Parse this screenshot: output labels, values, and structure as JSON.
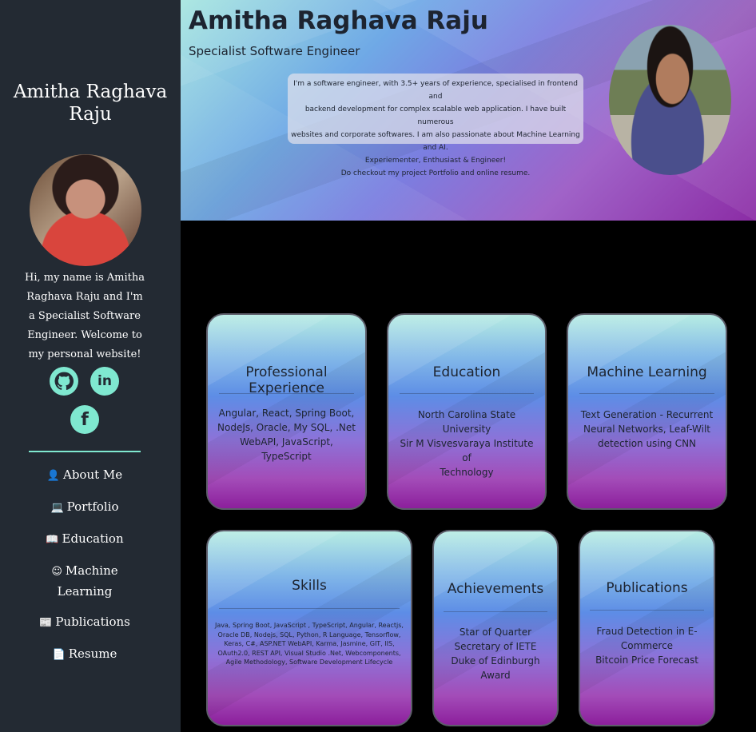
{
  "sidebar": {
    "name": "Amitha Raghava Raju",
    "intro": "Hi, my name is Amitha Raghava Raju and I'm a Specialist Software Engineer. Welcome to my personal website!",
    "nav": [
      {
        "label": "About Me",
        "icon": "user-icon"
      },
      {
        "label": "Portfolio",
        "icon": "laptop-icon"
      },
      {
        "label": "Education",
        "icon": "book-icon"
      },
      {
        "label": "Machine Learning",
        "icon": "accessibility-icon"
      },
      {
        "label": "Publications",
        "icon": "newspaper-icon"
      },
      {
        "label": "Resume",
        "icon": "file-icon"
      }
    ],
    "social": {
      "github_glyph": "⬤",
      "linkedin_glyph": "in",
      "facebook_glyph": "f"
    },
    "accent_color": "#7fe8d0"
  },
  "header": {
    "name": "Amitha Raghava Raju",
    "role": "Specialist Software Engineer",
    "bio_lines": [
      "I'm a software engineer, with 3.5+ years of experience, specialised in frontend and",
      "backend development for complex scalable web application. I have built numerous",
      "websites and corporate softwares. I am also passionate about Machine Learning and AI.",
      "Experiementer, Enthusiast & Engineer!",
      "Do checkout my project Portfolio and online resume."
    ]
  },
  "cards": {
    "experience": {
      "title": "Professional Experience",
      "lines": [
        "Angular, React, Spring Boot,",
        "NodeJs, Oracle, My SQL, .Net",
        "WebAPI, JavaScript, TypeScript"
      ]
    },
    "education": {
      "title": "Education",
      "lines": [
        "North Carolina State University",
        "Sir M Visvesvaraya Institute of",
        "Technology"
      ]
    },
    "ml": {
      "title": "Machine Learning",
      "lines": [
        "Text Generation - Recurrent",
        "Neural Networks, Leaf-Wilt",
        "detection using CNN"
      ]
    },
    "skills": {
      "title": "Skills",
      "lines": [
        "Java, Spring Boot, JavaScript , TypeScript, Angular, Reactjs,",
        "Oracle DB, Nodejs, SQL, Python, R Language, Tensorflow,",
        "Keras, C#, ASP.NET WebAPI, Karma, Jasmine, GIT, IIS,",
        "OAuth2.0, REST API, Visual Studio .Net, Webcomponents,",
        "Agile Methodology, Software Development Lifecycle"
      ]
    },
    "achievements": {
      "title": "Achievements",
      "lines": [
        "Star of Quarter",
        "Secretary of IETE",
        "Duke of Edinburgh Award"
      ]
    },
    "publications": {
      "title": "Publications",
      "lines": [
        "Fraud Detection in E-",
        "Commerce",
        "Bitcoin Price Forecast"
      ]
    }
  }
}
